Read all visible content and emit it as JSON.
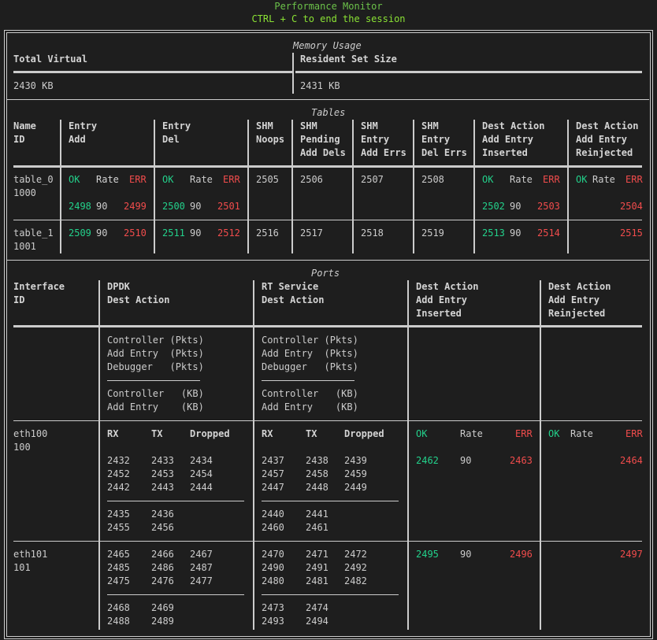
{
  "title": "Performance Monitor",
  "subtitle": "CTRL + C to end the session",
  "memory": {
    "section": "Memory Usage",
    "col1": "Total Virtual",
    "col2": "Resident Set Size",
    "val1": "2430 KB",
    "val2": "2431 KB"
  },
  "tables": {
    "section": "Tables",
    "headers": {
      "name": "Name\nID",
      "entry_add": "Entry\nAdd",
      "entry_del": "Entry\nDel",
      "shm_noops": "SHM\nNoops",
      "shm_pending": "SHM\nPending\nAdd Dels",
      "shm_entry_add_errs": "SHM\nEntry\nAdd Errs",
      "shm_entry_del_errs": "SHM\nEntry\nDel Errs",
      "dest_inserted": "Dest Action\nAdd Entry\nInserted",
      "dest_reinjected": "Dest Action\nAdd Entry\nReinjected"
    },
    "sub": {
      "ok": "OK",
      "rate": "Rate",
      "err": "ERR"
    },
    "rows": [
      {
        "name": "table_0",
        "id": "1000",
        "add_ok": "2498",
        "add_rate": "90",
        "add_err": "2499",
        "del_ok": "2500",
        "del_rate": "90",
        "del_err": "2501",
        "noops": "2505",
        "pending": "2506",
        "add_errs": "2507",
        "del_errs": "2508",
        "ins_ok": "2502",
        "ins_rate": "90",
        "ins_err": "2503",
        "rein_err": "2504"
      },
      {
        "name": "table_1",
        "id": "1001",
        "add_ok": "2509",
        "add_rate": "90",
        "add_err": "2510",
        "del_ok": "2511",
        "del_rate": "90",
        "del_err": "2512",
        "noops": "2516",
        "pending": "2517",
        "add_errs": "2518",
        "del_errs": "2519",
        "ins_ok": "2513",
        "ins_rate": "90",
        "ins_err": "2514",
        "rein_err": "2515"
      }
    ]
  },
  "ports": {
    "section": "Ports",
    "headers": {
      "iface": "Interface\nID",
      "dpdk": "DPDK\nDest Action",
      "rt": "RT Service\nDest Action",
      "dest_inserted": "Dest Action\nAdd Entry\nInserted",
      "dest_reinjected": "Dest Action\nAdd Entry\nReinjected"
    },
    "legend_pkts": "Controller (Pkts)\nAdd Entry  (Pkts)\nDebugger   (Pkts)",
    "legend_kb": "Controller   (KB)\nAdd Entry    (KB)",
    "sub": {
      "rx": "RX",
      "tx": "TX",
      "dropped": "Dropped",
      "ok": "OK",
      "rate": "Rate",
      "err": "ERR"
    },
    "rows": [
      {
        "iface": "eth100\n100",
        "dpdk_rx": "2432\n2452\n2442",
        "dpdk_tx": "2433\n2453\n2443",
        "dpdk_drop": "2434\n2454\n2444",
        "dpdk_kb_rx": "2435\n2455",
        "dpdk_kb_tx": "2436\n2456",
        "rt_rx": "2437\n2457\n2447",
        "rt_tx": "2438\n2458\n2448",
        "rt_drop": "2439\n2459\n2449",
        "rt_kb_rx": "2440\n2460",
        "rt_kb_tx": "2441\n2461",
        "ins_ok": "2462",
        "ins_rate": "90",
        "ins_err": "2463",
        "rein_err": "2464"
      },
      {
        "iface": "eth101\n101",
        "dpdk_rx": "2465\n2485\n2475",
        "dpdk_tx": "2466\n2486\n2476",
        "dpdk_drop": "2467\n2487\n2477",
        "dpdk_kb_rx": "2468\n2488",
        "dpdk_kb_tx": "2469\n2489",
        "rt_rx": "2470\n2490\n2480",
        "rt_tx": "2471\n2491\n2481",
        "rt_drop": "2472\n2492\n2482",
        "rt_kb_rx": "2473\n2493",
        "rt_kb_tx": "2474\n2494",
        "ins_ok": "2495",
        "ins_rate": "90",
        "ins_err": "2496",
        "rein_err": "2497"
      }
    ]
  }
}
